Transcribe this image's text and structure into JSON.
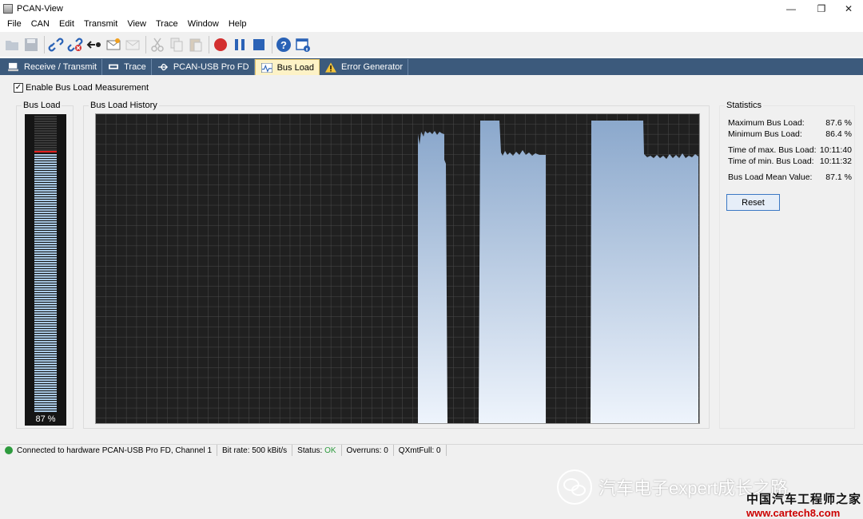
{
  "window": {
    "title": "PCAN-View",
    "controls": {
      "minimize": "—",
      "restore": "❐",
      "close": "✕"
    }
  },
  "menu": [
    "File",
    "CAN",
    "Edit",
    "Transmit",
    "View",
    "Trace",
    "Window",
    "Help"
  ],
  "toolbar": {
    "icons": [
      "open-icon",
      "save-icon",
      "connect-icon",
      "disconnect-icon",
      "reset-icon",
      "message-icon",
      "message-disabled-icon",
      "cut-icon",
      "copy-icon",
      "paste-icon",
      "record-icon",
      "pause-icon",
      "stop-icon",
      "help-icon",
      "info-icon"
    ]
  },
  "tabs": [
    {
      "label": "Receive / Transmit",
      "icon": "receive-transmit-icon"
    },
    {
      "label": "Trace",
      "icon": "trace-icon"
    },
    {
      "label": "PCAN-USB Pro FD",
      "icon": "usb-icon"
    },
    {
      "label": "Bus Load",
      "icon": "bus-load-icon",
      "active": true
    },
    {
      "label": "Error Generator",
      "icon": "warning-icon"
    }
  ],
  "busload": {
    "enable_label": "Enable Bus Load Measurement",
    "enabled": true,
    "gauge_label": "Bus Load",
    "gauge_value_text": "87 %",
    "gauge_level": 0.87,
    "gauge_max_level": 0.876,
    "history_label": "Bus Load History"
  },
  "statistics": {
    "title": "Statistics",
    "rows": [
      {
        "label": "Maximum Bus Load:",
        "value": "87.6 %"
      },
      {
        "label": "Minimum Bus Load:",
        "value": "86.4 %"
      },
      {
        "label": "Time of max. Bus Load:",
        "value": "10:11:40"
      },
      {
        "label": "Time of min. Bus Load:",
        "value": "10:11:32"
      },
      {
        "label": "Bus Load Mean Value:",
        "value": "87.1 %"
      }
    ],
    "reset_label": "Reset"
  },
  "statusbar": {
    "connection": "Connected to hardware PCAN-USB Pro FD, Channel 1",
    "bitrate": "Bit rate: 500 kBit/s",
    "status_label": "Status:",
    "status_value": "OK",
    "overruns": "Overruns: 0",
    "qxmtfull": "QXmtFull: 0"
  },
  "colors": {
    "accent": "#3c5a7c",
    "tab_active": "#fdf2c6",
    "status_ok": "#2e9b3e",
    "record": "#d32f2f",
    "gauge_max": "#e02020"
  },
  "watermark": {
    "text": "汽车电子expert成长之路",
    "line1": "中国汽车工程师之家",
    "line2": "www.cartech8.com"
  }
}
